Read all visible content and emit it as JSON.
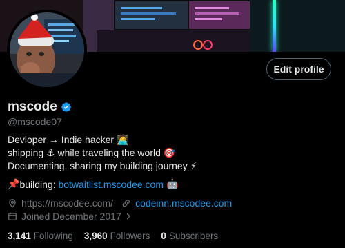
{
  "profile": {
    "name": "mscode",
    "handle": "@mscode07",
    "edit_label": "Edit profile",
    "bio": [
      {
        "text": "Devloper → Indie hacker",
        "emoji": "🧑‍💻"
      },
      {
        "text": "shipping ⚓ while traveling the world",
        "emoji": "🎯"
      },
      {
        "text": "Documenting, sharing my building journey",
        "emoji": "⚡"
      }
    ],
    "building": {
      "pin": "📌",
      "label": "building:",
      "link": "botwaitlist.mscodee.com",
      "emoji": "🤖"
    },
    "website": "https://mscodee.com/",
    "secondary_link": "codeinn.mscodee.com",
    "joined": "Joined December 2017",
    "stats": {
      "following_count": "3,141",
      "following_label": "Following",
      "followers_count": "3,960",
      "followers_label": "Followers",
      "subscribers_count": "0",
      "subscribers_label": "Subscribers"
    }
  },
  "colors": {
    "accent": "#1d9bf0",
    "muted": "#71767b",
    "text": "#e7e9ea",
    "background": "#000000"
  },
  "icons": [
    "verified-badge-icon",
    "location-icon",
    "link-icon",
    "calendar-icon",
    "chevron-right-icon"
  ]
}
